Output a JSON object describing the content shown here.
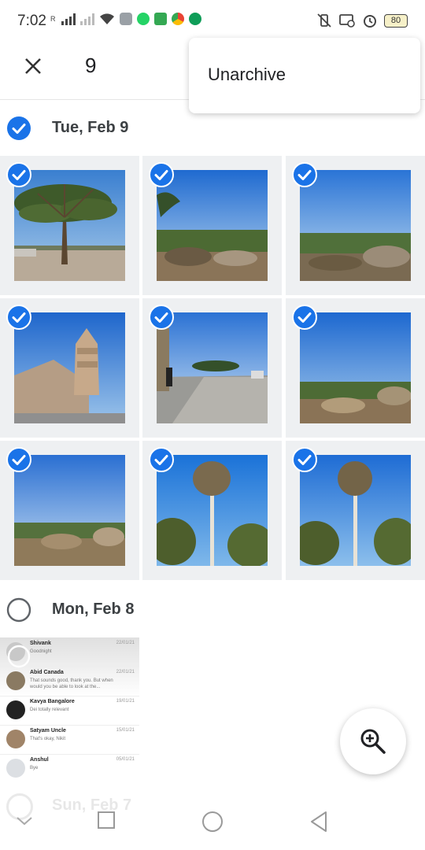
{
  "status_bar": {
    "time": "7:02",
    "battery": "80",
    "left_icons": [
      "signal-icon",
      "signal-icon",
      "wifi-icon",
      "app-icon",
      "whatsapp-icon",
      "puzzle-icon",
      "chrome-icon",
      "chat-icon"
    ],
    "right_icons": [
      "vibrate-off-icon",
      "cast-icon",
      "alarm-icon",
      "battery-icon"
    ]
  },
  "top_bar": {
    "selected_count": "9",
    "close_icon": "close-icon"
  },
  "menu": {
    "items": [
      {
        "label": "Unarchive"
      }
    ]
  },
  "sections": [
    {
      "date": "Tue, Feb 9",
      "selected": true
    },
    {
      "date": "Mon, Feb 8",
      "selected": false
    },
    {
      "date": "Sun, Feb 7",
      "selected": false
    }
  ],
  "photos": [
    {
      "kind": "tree-plaza",
      "selected": true
    },
    {
      "kind": "hill-view",
      "selected": true
    },
    {
      "kind": "hill-view",
      "selected": true
    },
    {
      "kind": "temple",
      "selected": true
    },
    {
      "kind": "path-temple",
      "selected": true
    },
    {
      "kind": "hill-view",
      "selected": true
    },
    {
      "kind": "hill-view",
      "selected": true
    },
    {
      "kind": "tall-tree",
      "selected": true
    },
    {
      "kind": "tall-tree",
      "selected": true
    }
  ],
  "chat_thumbnail": {
    "rows": [
      {
        "name": "Shivank",
        "message": "Goodnight",
        "date": "22/01/21"
      },
      {
        "name": "Abid Canada",
        "message": "That sounds good, thank you. But when would you be able to look at the...",
        "date": "22/01/21"
      },
      {
        "name": "Kavya Bangalore",
        "message": "Dei totally relevant",
        "date": "19/01/21"
      },
      {
        "name": "Satyam Uncle",
        "message": "That's okay, Nikit",
        "date": "15/01/21"
      },
      {
        "name": "Anshul",
        "message": "Bye",
        "date": "05/01/21"
      }
    ]
  },
  "fab": {
    "icon": "zoom-in-icon"
  },
  "colors": {
    "accent": "#1a73e8",
    "check_bg": "#1a73e8"
  }
}
